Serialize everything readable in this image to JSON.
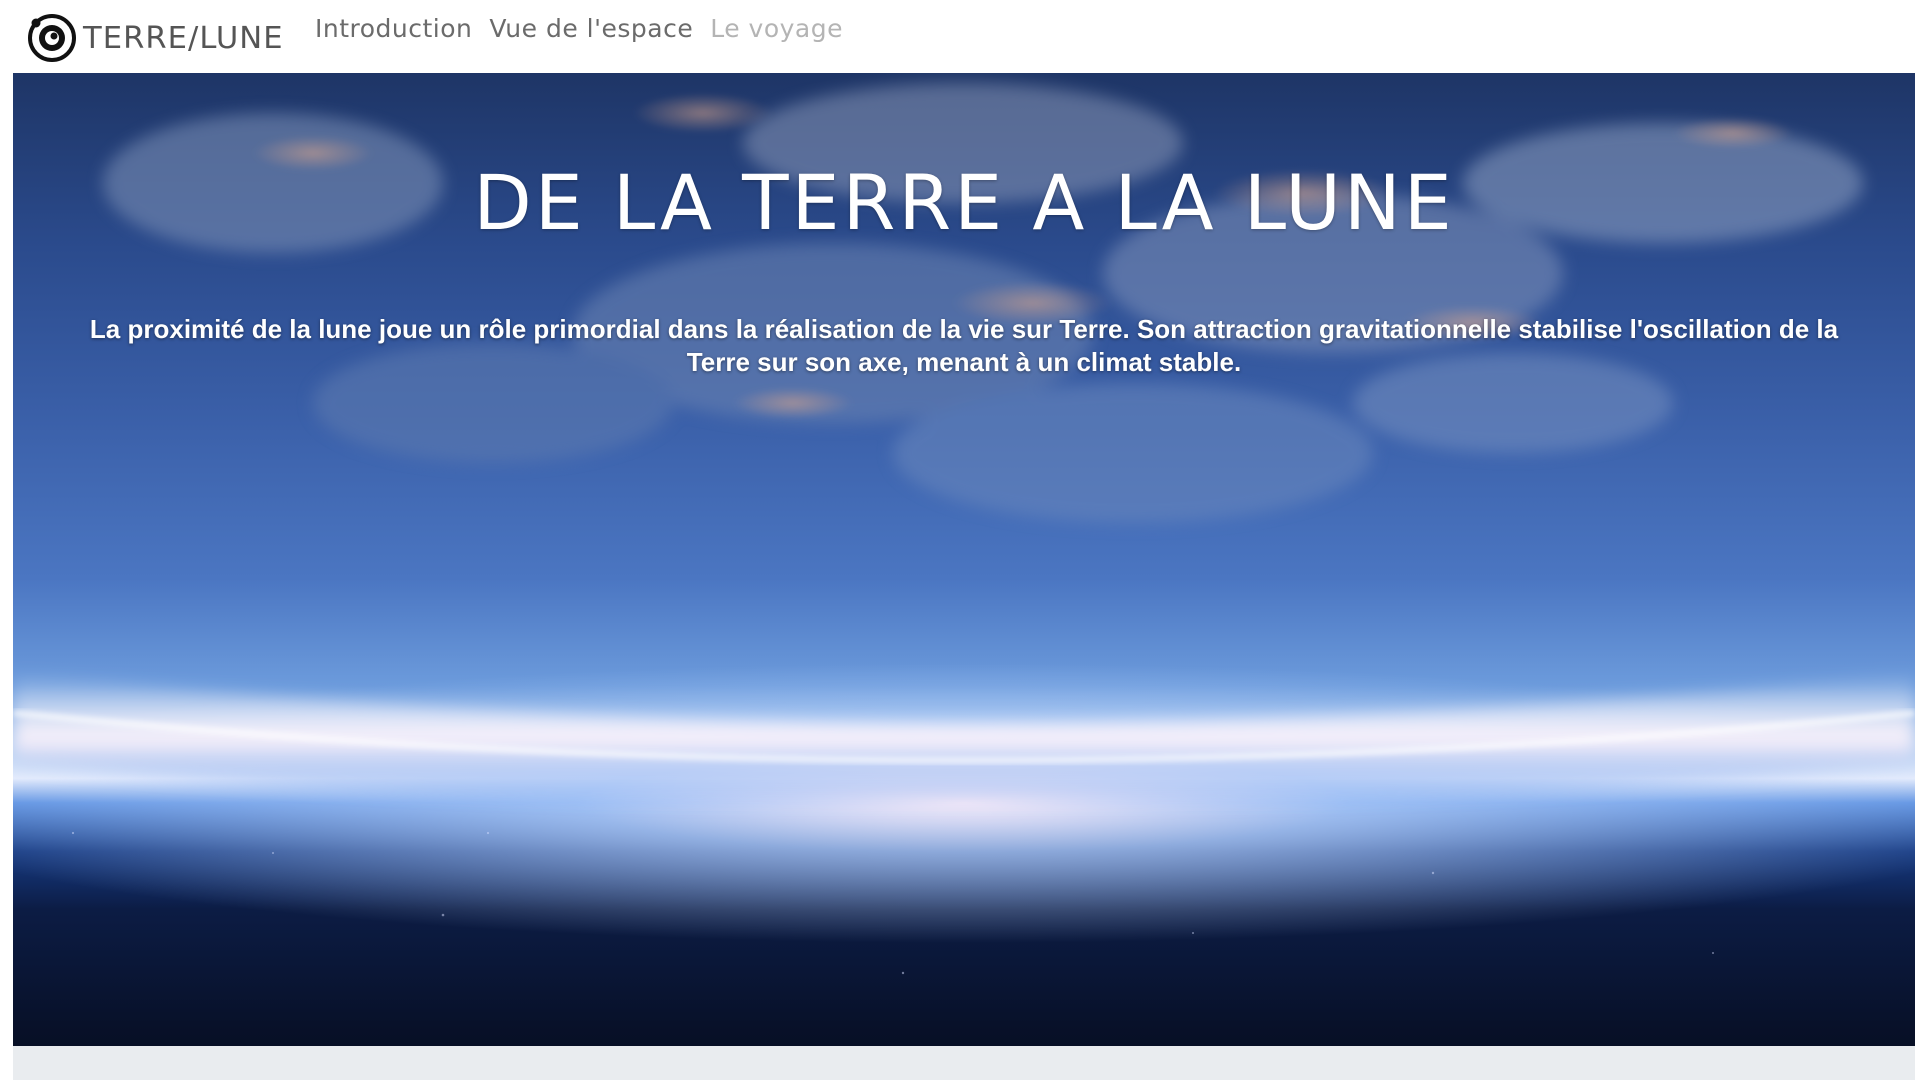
{
  "navbar": {
    "brand_label": "TERRE/LUNE",
    "logo_icon": "moon-orbit-logo-icon",
    "links": [
      {
        "label": "Introduction",
        "state": "normal"
      },
      {
        "label": "Vue de l'espace",
        "state": "normal"
      },
      {
        "label": "Le voyage",
        "state": "muted"
      }
    ]
  },
  "hero": {
    "title": "DE LA TERRE A LA LUNE",
    "text_line1": "La proximité de la lune joue un rôle primordial dans la réalisation  de la vie sur Terre. Son attraction gravitationnelle stabilise  l'oscillation de la",
    "text_line2": "Terre sur son axe, menant à un climat stable."
  },
  "colors": {
    "nav_text": "#6b6b6b",
    "nav_muted": "#b4b4b4",
    "hero_text": "#ffffff",
    "footer_strip": "#e9ecef"
  }
}
